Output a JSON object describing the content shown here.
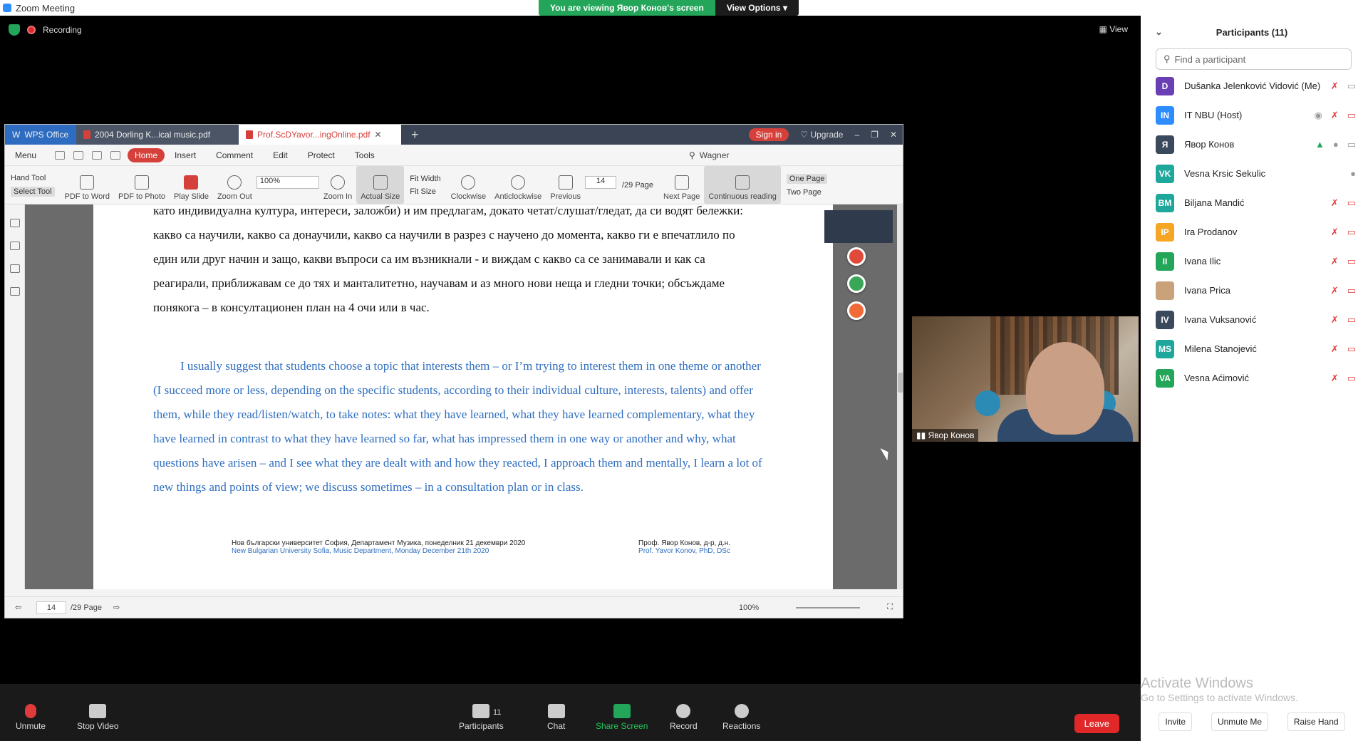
{
  "zoom": {
    "window_title": "Zoom Meeting",
    "viewing_banner": "You are viewing Явор Конов's screen",
    "view_options": "View Options",
    "recording": "Recording",
    "view": "View"
  },
  "wps": {
    "tabs": [
      "WPS Office",
      "2004 Dorling K...ical music.pdf",
      "Prof.ScDYavor...ingOnline.pdf"
    ],
    "sign_in": "Sign in",
    "upgrade": "Upgrade",
    "menu": [
      "Menu",
      "Home",
      "Insert",
      "Comment",
      "Edit",
      "Protect",
      "Tools"
    ],
    "search_value": "Wagner",
    "toolbar": {
      "hand_tool": "Hand Tool",
      "select_tool": "Select Tool",
      "pdf_to_word": "PDF to Word",
      "pdf_to_photo": "PDF to Photo",
      "play_slide": "Play Slide",
      "zoom_out": "Zoom Out",
      "zoom_value": "100%",
      "zoom_in": "Zoom In",
      "actual_size": "Actual Size",
      "fit_width": "Fit Width",
      "fit_size": "Fit Size",
      "clockwise": "Clockwise",
      "anticlockwise": "Anticlockwise",
      "previous": "Previous",
      "page_value": "14",
      "page_total": "/29 Page",
      "next_page": "Next Page",
      "continuous_reading": "Continuous reading",
      "one_page": "One Page",
      "two_page": "Two Page"
    },
    "doc": {
      "bg_paragraph": "като индивидуална култура, интереси, заложби) и им предлагам, докато четат/слушат/гледат, да си водят бележки: какво са научили, какво са донаучили, какво са научили в разрез с научено до момента, какво ги е впечатлило по един или друг начин и защо, какви въпроси са им възникнали - и виждам с какво са се занимавали и как са реагирали, приближавам се до тях и манталитетно, научавам и аз много нови неща и гледни точки; обсъждаме понякога – в консултационен план на 4 очи или в час.",
      "en_paragraph": "I usually suggest that students choose a topic that interests them – or I’m trying to interest them in one theme or another (I succeed more or less, depending on the specific students, according to their individual culture, interests, talents) and offer them, while they read/listen/watch, to take notes: what they have learned, what they have learned complementary, what they have learned in contrast to what they have learned so far, what has impressed them in one way or another and why, what questions have arisen – and I see what they are dealt with and how they reacted, I approach them and mentally, I learn a lot of new things and points of view; we discuss sometimes – in a consultation plan or in class.",
      "footer_left_bg": "Нов български университет София, Департамент Музика, понеделник 21 декември 2020",
      "footer_left_en": "New Bulgarian University Sofia, Music Department, Monday December 21th 2020",
      "footer_right_bg": "Проф. Явор Конов, д-р, д.н.",
      "footer_right_en": "Prof. Yavor Konov, PhD, DSc"
    },
    "status": {
      "page_value": "14",
      "page_total": "/29 Page",
      "zoom": "100%"
    }
  },
  "video": {
    "name": "Явор Конов"
  },
  "participants": {
    "title": "Participants (11)",
    "find_placeholder": "Find a participant",
    "list": [
      {
        "initials": "D",
        "name": "Dušanka Jelenković Vidović (Me)",
        "color": "#6a3fb5"
      },
      {
        "initials": "IN",
        "name": "IT NBU (Host)",
        "color": "#2d8cff"
      },
      {
        "initials": "Я",
        "name": "Явор Конов",
        "color": "#3a4a5c"
      },
      {
        "initials": "VK",
        "name": "Vesna Krsic Sekulic",
        "color": "#1fa79b"
      },
      {
        "initials": "BM",
        "name": "Biljana Mandić",
        "color": "#1fa79b"
      },
      {
        "initials": "IP",
        "name": "Ira Prodanov",
        "color": "#f5a623"
      },
      {
        "initials": "II",
        "name": "Ivana Ilic",
        "color": "#23a55a"
      },
      {
        "initials": "",
        "name": "Ivana Prica",
        "color": "#c9a27a"
      },
      {
        "initials": "IV",
        "name": "Ivana Vuksanović",
        "color": "#3a4a5c"
      },
      {
        "initials": "MS",
        "name": "Milena Stanojević",
        "color": "#1fa79b"
      },
      {
        "initials": "VA",
        "name": "Vesna Aćimović",
        "color": "#23a55a"
      }
    ],
    "invite": "Invite",
    "unmute_me": "Unmute Me",
    "raise_hand": "Raise Hand"
  },
  "activate": {
    "line1": "Activate Windows",
    "line2": "Go to Settings to activate Windows."
  },
  "bottom": {
    "unmute": "Unmute",
    "stop_video": "Stop Video",
    "participants": "Participants",
    "participants_count": "11",
    "chat": "Chat",
    "share_screen": "Share Screen",
    "record": "Record",
    "reactions": "Reactions",
    "leave": "Leave"
  }
}
